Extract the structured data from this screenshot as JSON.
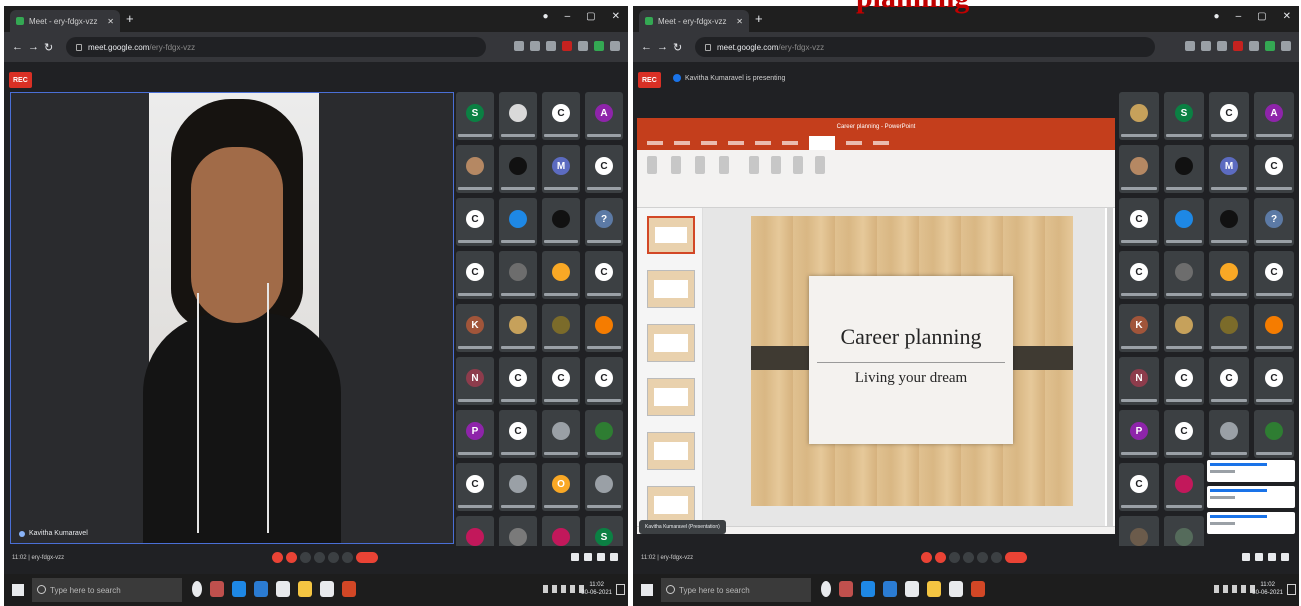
{
  "overlay": {
    "title_fragment": "planning"
  },
  "browser": {
    "tab_title": "Meet - ery-fdgx-vzz",
    "url_host": "meet.google.com",
    "url_path": "/ery-fdgx-vzz"
  },
  "taskbar": {
    "search_placeholder": "Type here to search",
    "time": "11:02",
    "date": "30-06-2021"
  },
  "left_screen": {
    "spotlight_name": "Kavitha Kumaravel",
    "meeting_code": "11:02 | ery-fdgx-vzz"
  },
  "right_screen": {
    "presenting_label": "Kavitha Kumaravel is presenting",
    "meeting_code": "11:02 | ery-fdgx-vzz",
    "ppt_window_title": "Career planning - PowerPoint",
    "share_pill": "Kavitha Kumaravel (Presentation)"
  },
  "slide": {
    "title": "Career planning",
    "subtitle": "Living your dream"
  },
  "colors": {
    "meet_bg": "#202124",
    "tile_bg": "#3c4043",
    "ppt_accent": "#c43e1c",
    "record_red": "#d93025",
    "overlay_red": "#c00000"
  },
  "tiles_left": [
    {
      "letter": "S",
      "color": "#0b8043"
    },
    {
      "letter": "",
      "color": "#d9d9d9"
    },
    {
      "letter": "C",
      "color": "#ffffff"
    },
    {
      "letter": "A",
      "color": "#8e24aa"
    },
    {
      "letter": "",
      "color": "#b58863"
    },
    {
      "letter": "",
      "color": "#111111"
    },
    {
      "letter": "M",
      "color": "#5c6bc0"
    },
    {
      "letter": "C",
      "color": "#ffffff"
    },
    {
      "letter": "C",
      "color": "#ffffff"
    },
    {
      "letter": "",
      "color": "#1e88e5"
    },
    {
      "letter": "",
      "color": "#111111"
    },
    {
      "letter": "?",
      "color": "#5c7aa5"
    },
    {
      "letter": "C",
      "color": "#ffffff"
    },
    {
      "letter": "",
      "color": "#6d6d6d"
    },
    {
      "letter": "",
      "color": "#f9a825"
    },
    {
      "letter": "C",
      "color": "#ffffff"
    },
    {
      "letter": "K",
      "color": "#a1553a"
    },
    {
      "letter": "",
      "color": "#c6a15b"
    },
    {
      "letter": "",
      "color": "#7b6b2a"
    },
    {
      "letter": "",
      "color": "#f57c00"
    },
    {
      "letter": "N",
      "color": "#8d3c4c"
    },
    {
      "letter": "C",
      "color": "#ffffff"
    },
    {
      "letter": "C",
      "color": "#ffffff"
    },
    {
      "letter": "C",
      "color": "#ffffff"
    },
    {
      "letter": "P",
      "color": "#8e24aa"
    },
    {
      "letter": "C",
      "color": "#ffffff"
    },
    {
      "letter": "",
      "color": "#9aa0a6"
    },
    {
      "letter": "",
      "color": "#2e7d32"
    },
    {
      "letter": "C",
      "color": "#ffffff"
    },
    {
      "letter": "",
      "color": "#9aa0a6"
    },
    {
      "letter": "O",
      "color": "#f9a825"
    },
    {
      "letter": "",
      "color": "#9aa0a6"
    },
    {
      "letter": "",
      "color": "#c2185b"
    },
    {
      "letter": "",
      "color": "#7a7a7a"
    },
    {
      "letter": "",
      "color": "#c2185b"
    },
    {
      "letter": "S",
      "color": "#0b8043"
    }
  ],
  "tiles_right": [
    {
      "letter": "",
      "color": "#c6a15b"
    },
    {
      "letter": "S",
      "color": "#0b8043"
    },
    {
      "letter": "C",
      "color": "#ffffff"
    },
    {
      "letter": "A",
      "color": "#8e24aa"
    },
    {
      "letter": "",
      "color": "#b58863"
    },
    {
      "letter": "",
      "color": "#111111"
    },
    {
      "letter": "M",
      "color": "#5c6bc0"
    },
    {
      "letter": "C",
      "color": "#ffffff"
    },
    {
      "letter": "C",
      "color": "#ffffff"
    },
    {
      "letter": "",
      "color": "#1e88e5"
    },
    {
      "letter": "",
      "color": "#111111"
    },
    {
      "letter": "?",
      "color": "#5c7aa5"
    },
    {
      "letter": "C",
      "color": "#ffffff"
    },
    {
      "letter": "",
      "color": "#6d6d6d"
    },
    {
      "letter": "",
      "color": "#f9a825"
    },
    {
      "letter": "C",
      "color": "#ffffff"
    },
    {
      "letter": "K",
      "color": "#a1553a"
    },
    {
      "letter": "",
      "color": "#c6a15b"
    },
    {
      "letter": "",
      "color": "#7b6b2a"
    },
    {
      "letter": "",
      "color": "#f57c00"
    },
    {
      "letter": "N",
      "color": "#8d3c4c"
    },
    {
      "letter": "C",
      "color": "#ffffff"
    },
    {
      "letter": "C",
      "color": "#ffffff"
    },
    {
      "letter": "C",
      "color": "#ffffff"
    },
    {
      "letter": "P",
      "color": "#8e24aa"
    },
    {
      "letter": "C",
      "color": "#ffffff"
    },
    {
      "letter": "",
      "color": "#9aa0a6"
    },
    {
      "letter": "",
      "color": "#2e7d32"
    },
    {
      "letter": "C",
      "color": "#ffffff"
    },
    {
      "letter": "",
      "color": "#c2185b"
    },
    {
      "letter": "",
      "color": "#202124"
    },
    {
      "letter": "",
      "color": "#202124"
    },
    {
      "letter": "",
      "color": "#6b5b4b"
    },
    {
      "letter": "",
      "color": "#556b5b"
    },
    {
      "letter": "",
      "color": "#202124"
    },
    {
      "letter": "",
      "color": "#202124"
    }
  ]
}
